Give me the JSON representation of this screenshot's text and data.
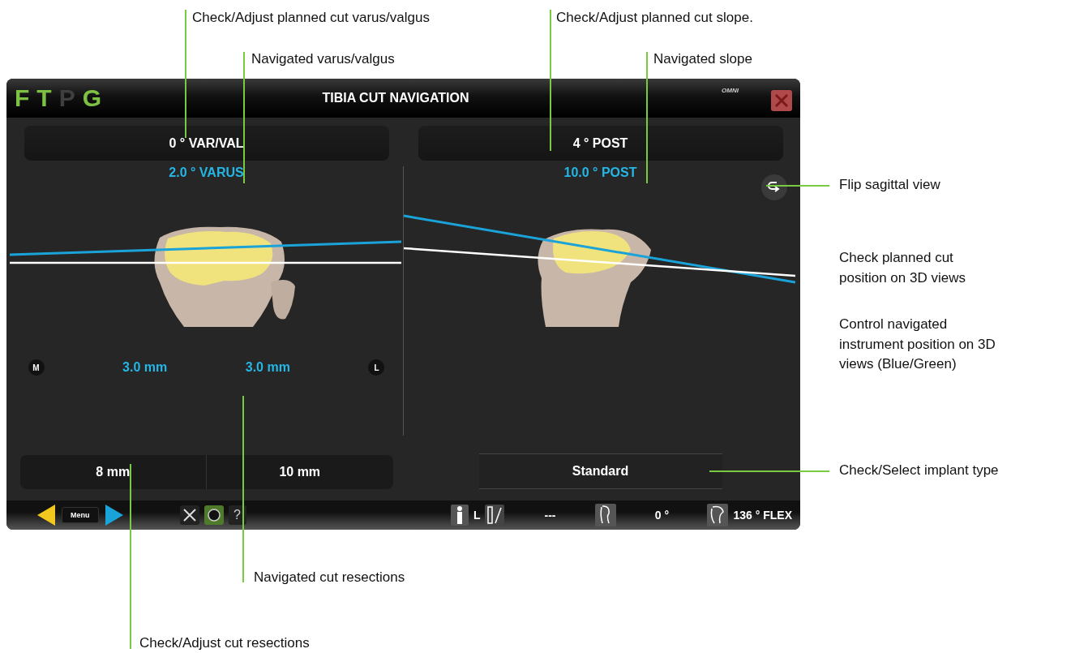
{
  "screen": {
    "logo": {
      "letters": [
        {
          "char": "F",
          "active": true
        },
        {
          "char": "T",
          "active": true
        },
        {
          "char": "P",
          "active": false
        },
        {
          "char": "G",
          "active": true
        }
      ]
    },
    "title": "TIBIA CUT NAVIGATION",
    "brand": "OMNI",
    "coronal": {
      "planned": "0 ° VAR/VAL",
      "navigated": "2.0 ° VARUS",
      "medial_label": "M",
      "lateral_label": "L",
      "medial_resection": "3.0 mm",
      "lateral_resection": "3.0 mm",
      "planned_resections": [
        "8 mm",
        "10 mm"
      ]
    },
    "sagittal": {
      "planned": "4 ° POST",
      "navigated": "10.0 ° POST",
      "implant_type": "Standard"
    },
    "bottom_bar": {
      "menu": "Menu",
      "help": "?",
      "side": "L",
      "instrument": "---",
      "angle": "0 °",
      "flexion": "136 ° FLEX"
    }
  },
  "callouts": {
    "planned_varus_valgus": "Check/Adjust planned cut varus/valgus",
    "navigated_varus_valgus": "Navigated varus/valgus",
    "planned_slope": "Check/Adjust planned cut slope.",
    "navigated_slope": "Navigated slope",
    "flip": "Flip sagittal view",
    "planned_position": "Check planned cut position on 3D views",
    "navigated_position": "Control navigated instrument position on 3D views (Blue/Green)",
    "implant": "Check/Select implant type",
    "navigated_resections": "Navigated cut resections",
    "planned_resections": "Check/Adjust cut resections"
  }
}
